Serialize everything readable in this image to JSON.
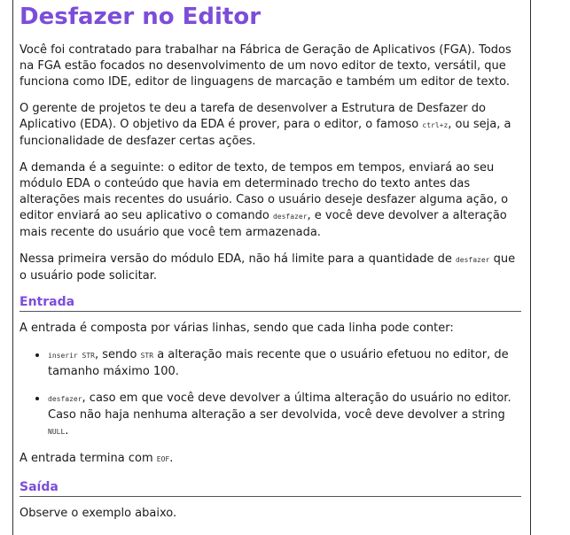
{
  "title": "Desfazer no Editor",
  "intro": {
    "p1": "Você foi contratado para trabalhar na Fábrica de Geração de Aplicativos (FGA). Todos na FGA estão focados no desenvolvimento de um novo editor de texto, versátil, que funciona como IDE, editor de linguagens de marcação e também um editor de texto.",
    "p2_a": "O gerente de projetos te deu a tarefa de desenvolver a Estrutura de Desfazer do Aplicativo (EDA). O objetivo da EDA é prover, para o editor, o famoso ",
    "p2_code": "ctrl+z",
    "p2_b": ", ou seja, a funcionalidade de desfazer certas ações.",
    "p3_a": "A demanda é a seguinte: o editor de texto, de tempos em tempos, enviará ao seu módulo EDA o conteúdo que havia em determinado trecho do texto antes das alterações mais recentes do usuário. Caso o usuário deseje desfazer alguma ação, o editor enviará ao seu aplicativo o comando ",
    "p3_code": "desfazer",
    "p3_b": ", e você deve devolver a alteração mais recente do usuário que você tem armazenada.",
    "p4_a": "Nessa primeira versão do módulo EDA, não há limite para a quantidade de ",
    "p4_code": "desfazer",
    "p4_b": " que o usuário pode solicitar."
  },
  "entrada": {
    "heading": "Entrada",
    "p1": "A entrada é composta por várias linhas, sendo que cada linha pode conter:",
    "item1_code": "inserir STR",
    "item1_a": ", sendo ",
    "item1_code2": "STR",
    "item1_b": " a alteração mais recente que o usuário efetuou no editor, de tamanho máximo 100.",
    "item2_code": "desfazer",
    "item2_a": ", caso em que você deve devolver a última alteração do usuário no editor. Caso não haja nenhuma alteração a ser devolvida, você deve devolver a string ",
    "item2_code2": "NULL",
    "item2_b": ".",
    "end_a": "A entrada termina com ",
    "end_code": "EOF",
    "end_b": "."
  },
  "saida": {
    "heading": "Saída",
    "p1": "Observe o exemplo abaixo."
  },
  "colors": {
    "heading": "#7c4dd9",
    "text": "#1a1a1a"
  }
}
